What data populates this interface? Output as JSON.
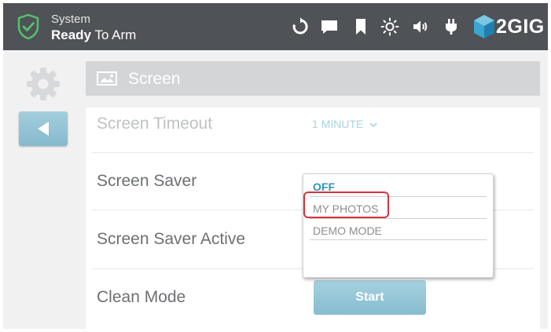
{
  "topbar": {
    "status_line1": "System",
    "status_bold": "Ready",
    "status_rest": " To Arm",
    "brand": "2GIG",
    "icons": [
      "shield-check-icon",
      "refresh-icon",
      "message-icon",
      "bookmark-icon",
      "brightness-icon",
      "volume-icon",
      "power-plug-icon",
      "2gig-cube-icon"
    ]
  },
  "header": {
    "title": "Screen",
    "icon": "picture-icon"
  },
  "sidebar": {
    "icons": [
      "gear-icon",
      "back-arrow-icon"
    ]
  },
  "settings": {
    "rows": [
      {
        "label": "Screen Timeout",
        "value": "1 MINUTE"
      },
      {
        "label": "Screen Saver"
      },
      {
        "label": "Screen Saver Active"
      },
      {
        "label": "Clean Mode",
        "button": "Start"
      }
    ]
  },
  "dropdown": {
    "options": [
      "OFF",
      "MY PHOTOS",
      "DEMO MODE"
    ],
    "selected": "OFF",
    "highlighted": "MY PHOTOS"
  },
  "colors": {
    "topbar": "#4f5256",
    "accent": "#8fc6d8",
    "selected_option": "#2d95b7",
    "highlight": "#d9323a",
    "shield_green": "#55c26c"
  }
}
